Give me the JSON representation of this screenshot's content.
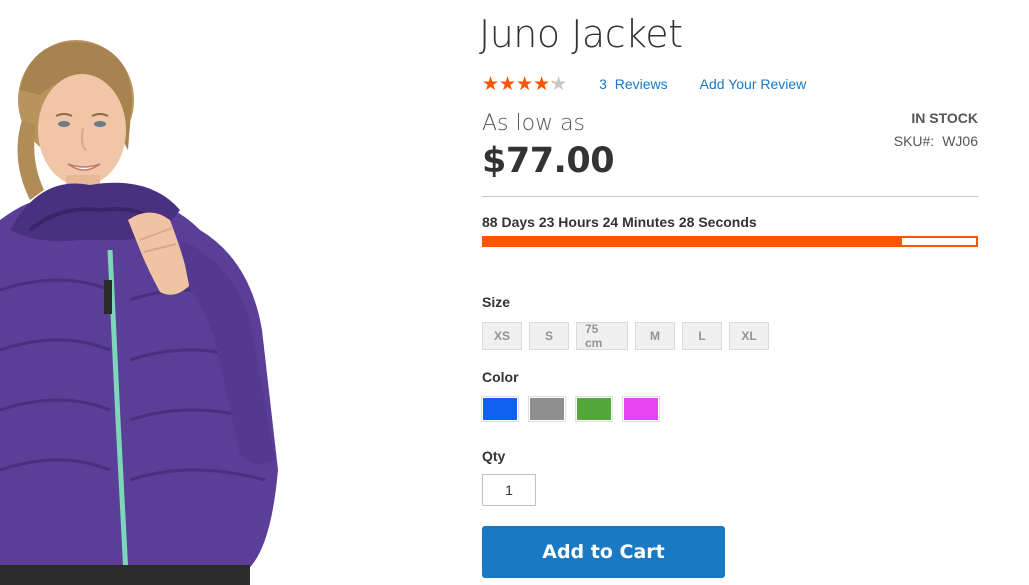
{
  "product": {
    "name": "Juno Jacket",
    "rating_fraction": 0.83,
    "reviews_count": "3",
    "reviews_label": "Reviews",
    "add_review_label": "Add Your Review",
    "price_prefix": "As low as",
    "price": "$77.00",
    "stock_status": "In stock",
    "sku_label": "SKU#:",
    "sku_value": "WJ06",
    "image_icon": "product-photo-woman-purple-jacket"
  },
  "countdown": {
    "text": "88 Days 23 Hours 24 Minutes 28 Seconds",
    "progress_fraction": 0.85
  },
  "options": {
    "size_label": "Size",
    "sizes": [
      "XS",
      "S",
      "75 cm",
      "M",
      "L",
      "XL"
    ],
    "color_label": "Color",
    "colors": [
      "#1061f0",
      "#8f8f8f",
      "#53a83a",
      "#e546f0"
    ]
  },
  "qty": {
    "label": "Qty",
    "value": "1"
  },
  "cart": {
    "button_label": "Add to Cart"
  },
  "colors": {
    "accent": "#ff5501",
    "link": "#1979c3",
    "button": "#1979c3"
  }
}
